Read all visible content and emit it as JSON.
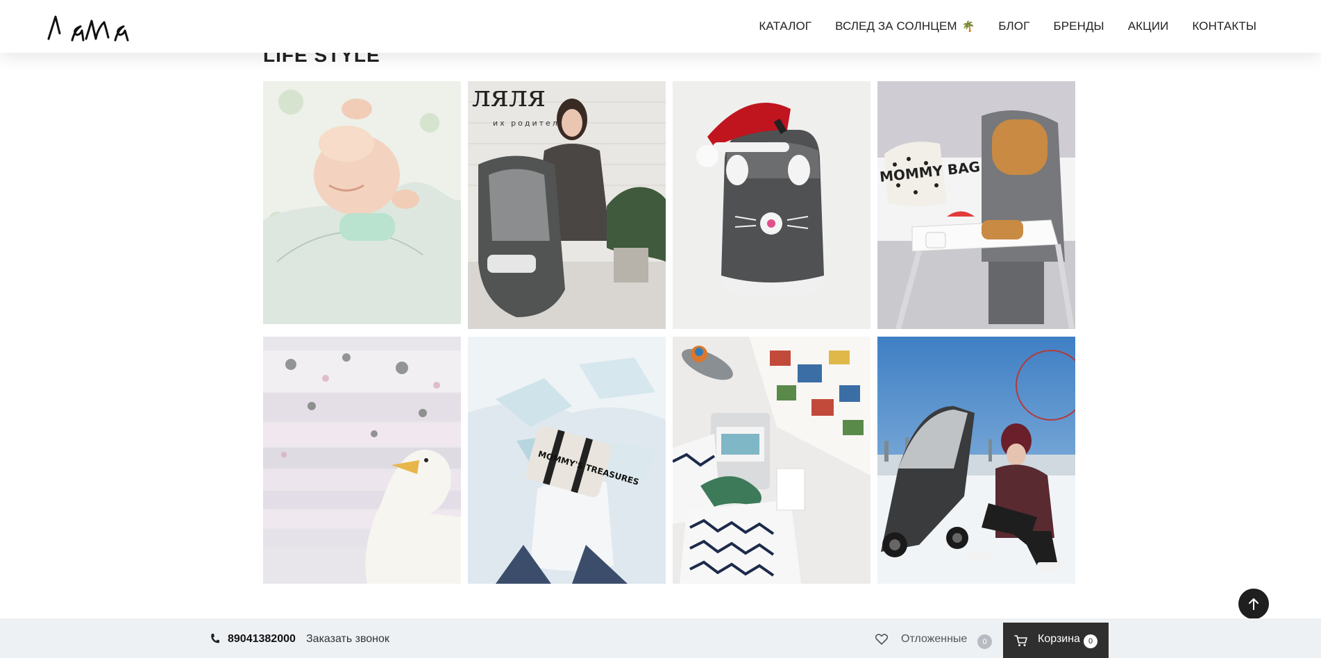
{
  "header": {
    "logo_text": "ляля",
    "nav": [
      {
        "label": "КАТАЛОГ"
      },
      {
        "label": "ВСЛЕД ЗА СОЛНЦЕМ"
      },
      {
        "label": "БЛОГ"
      },
      {
        "label": "БРЕНДЫ"
      },
      {
        "label": "АКЦИИ"
      },
      {
        "label": "КОНТАКТЫ"
      }
    ],
    "palm_icon": "🌴"
  },
  "section": {
    "title": "LIFE STYLE"
  },
  "gallery": {
    "items": [
      {
        "subject": "sleeping baby on muslin blanket"
      },
      {
        "subject": "woman with car seat in showroom",
        "sign_text": "ляля",
        "sign_sub": "их родителей"
      },
      {
        "subject": "kids ride-on suitcase with santa hat"
      },
      {
        "subject": "high chair with bib and tableware",
        "bag_text": "MOMMY BAG"
      },
      {
        "subject": "stack of folded floral muslin with swan toy"
      },
      {
        "subject": "child in snow holding pouch",
        "pouch_text": "MOMMY'S TREASURES"
      },
      {
        "subject": "flat lay with book, toys and swaddles"
      },
      {
        "subject": "mother with stroller on ice"
      }
    ]
  },
  "bottom_bar": {
    "phone": "89041382000",
    "callback": "Заказать звонок",
    "deferred_label": "Отложенные",
    "deferred_count": "0",
    "cart_label": "Корзина",
    "cart_count": "0"
  },
  "icons": {
    "phone": "phone-icon",
    "heart": "heart-icon",
    "cart": "cart-icon",
    "arrow_up": "arrow-up-icon"
  }
}
